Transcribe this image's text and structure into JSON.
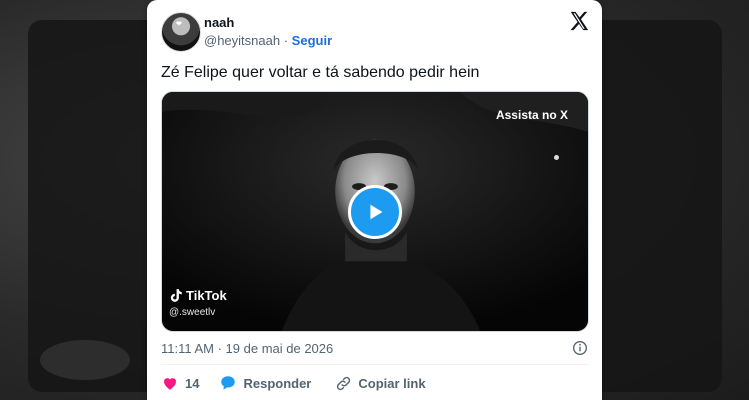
{
  "tweet": {
    "display_name": "naah",
    "handle": "@heyitsnaah",
    "separator": "·",
    "follow_label": "Seguir",
    "text": "Zé Felipe quer voltar e tá sabendo pedir hein",
    "timestamp": "11:11 AM · 19 de mai de 2026"
  },
  "media": {
    "watch_label": "Assista no X",
    "tiktok_label": "TikTok",
    "tiktok_user": "@.sweetlv"
  },
  "actions": {
    "like_count": "14",
    "reply_label": "Responder",
    "copy_link_label": "Copiar link"
  },
  "colors": {
    "link_blue": "#1d6fdb",
    "play_blue": "#1d9bf0",
    "heart_pink": "#f91880",
    "reply_blue": "#1d9bf0"
  },
  "icons": [
    "x-logo-icon",
    "play-icon",
    "tiktok-icon",
    "info-icon",
    "heart-icon",
    "reply-icon",
    "link-icon"
  ]
}
